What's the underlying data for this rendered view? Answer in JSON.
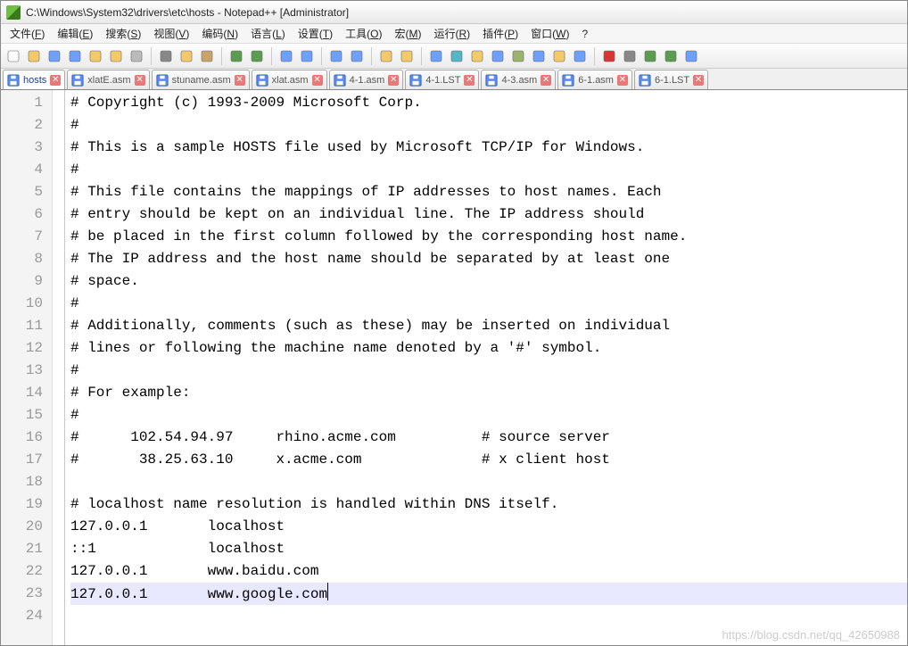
{
  "window": {
    "title": "C:\\Windows\\System32\\drivers\\etc\\hosts - Notepad++ [Administrator]"
  },
  "menu": {
    "items": [
      {
        "label": "文件",
        "accel": "F"
      },
      {
        "label": "编辑",
        "accel": "E"
      },
      {
        "label": "搜索",
        "accel": "S"
      },
      {
        "label": "视图",
        "accel": "V"
      },
      {
        "label": "编码",
        "accel": "N"
      },
      {
        "label": "语言",
        "accel": "L"
      },
      {
        "label": "设置",
        "accel": "T"
      },
      {
        "label": "工具",
        "accel": "O"
      },
      {
        "label": "宏",
        "accel": "M"
      },
      {
        "label": "运行",
        "accel": "R"
      },
      {
        "label": "插件",
        "accel": "P"
      },
      {
        "label": "窗口",
        "accel": "W"
      },
      {
        "label": "?",
        "accel": ""
      }
    ]
  },
  "tabs": [
    {
      "label": "hosts",
      "active": true
    },
    {
      "label": "xlatE.asm",
      "active": false
    },
    {
      "label": "stuname.asm",
      "active": false
    },
    {
      "label": "xlat.asm",
      "active": false
    },
    {
      "label": "4-1.asm",
      "active": false
    },
    {
      "label": "4-1.LST",
      "active": false
    },
    {
      "label": "4-3.asm",
      "active": false
    },
    {
      "label": "6-1.asm",
      "active": false
    },
    {
      "label": "6-1.LST",
      "active": false
    }
  ],
  "code": {
    "current_line": 23,
    "lines": [
      "# Copyright (c) 1993-2009 Microsoft Corp.",
      "#",
      "# This is a sample HOSTS file used by Microsoft TCP/IP for Windows.",
      "#",
      "# This file contains the mappings of IP addresses to host names. Each",
      "# entry should be kept on an individual line. The IP address should",
      "# be placed in the first column followed by the corresponding host name.",
      "# The IP address and the host name should be separated by at least one",
      "# space.",
      "#",
      "# Additionally, comments (such as these) may be inserted on individual",
      "# lines or following the machine name denoted by a '#' symbol.",
      "#",
      "# For example:",
      "#",
      "#      102.54.94.97     rhino.acme.com          # source server",
      "#       38.25.63.10     x.acme.com              # x client host",
      "",
      "# localhost name resolution is handled within DNS itself.",
      "127.0.0.1       localhost",
      "::1             localhost",
      "127.0.0.1       www.baidu.com",
      "127.0.0.1       www.google.com",
      ""
    ]
  },
  "watermark": "https://blog.csdn.net/qq_42650988",
  "toolbar_icons": [
    "new-file",
    "open-file",
    "save",
    "save-all",
    "close",
    "close-all",
    "print",
    "sep",
    "cut",
    "copy",
    "paste",
    "sep",
    "undo",
    "redo",
    "sep",
    "find",
    "replace",
    "sep",
    "zoom-in",
    "zoom-out",
    "sep",
    "sync-v",
    "sync-h",
    "sep",
    "word-wrap",
    "show-all",
    "indent-guide",
    "lang",
    "doc-map",
    "func-list",
    "folder",
    "monitor",
    "sep",
    "record-macro",
    "stop-macro",
    "play-macro",
    "fast-macro",
    "save-macro"
  ]
}
